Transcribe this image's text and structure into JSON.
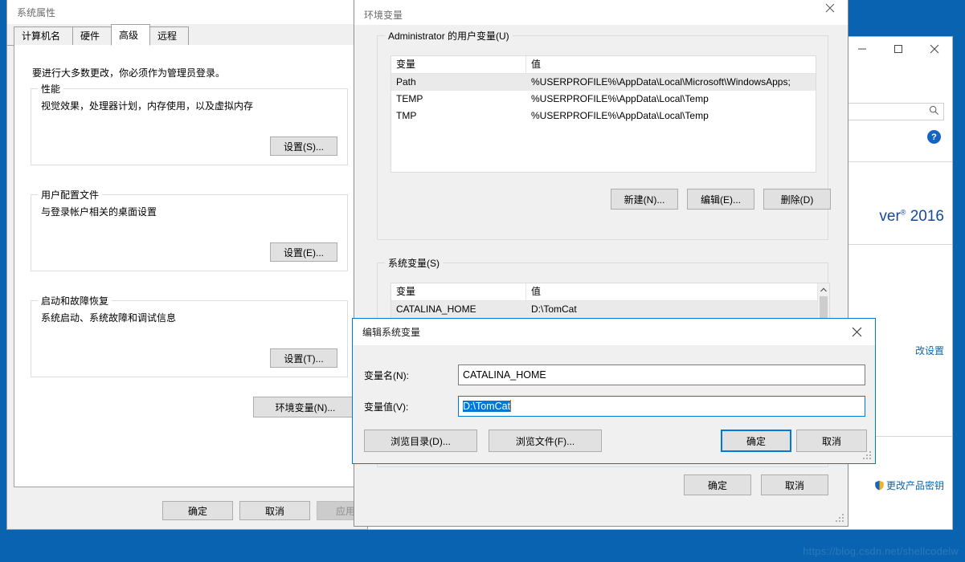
{
  "desktop": {
    "background_color": "#0963b0",
    "watermark": "https://blog.csdn.net/shellcodelw"
  },
  "control_panel_window": {
    "name": "system-control-panel",
    "minimize_label": "—",
    "maximize_label": "□",
    "close_label": "✕",
    "search_placeholder": "",
    "help_label": "?",
    "edition_text": "ver",
    "edition_trademark": "®",
    "edition_year": "2016",
    "change_settings_link": "改设置",
    "change_product_key_link": "更改产品密钥"
  },
  "system_properties": {
    "title": "系统属性",
    "tabs": [
      {
        "label": "计算机名",
        "active": false
      },
      {
        "label": "硬件",
        "active": false
      },
      {
        "label": "高级",
        "active": true
      },
      {
        "label": "远程",
        "active": false
      }
    ],
    "admin_note": "要进行大多数更改，你必须作为管理员登录。",
    "groups": [
      {
        "legend": "性能",
        "description": "视觉效果，处理器计划，内存使用，以及虚拟内存",
        "button": "设置(S)..."
      },
      {
        "legend": "用户配置文件",
        "description": "与登录帐户相关的桌面设置",
        "button": "设置(E)..."
      },
      {
        "legend": "启动和故障恢复",
        "description": "系统启动、系统故障和调试信息",
        "button": "设置(T)..."
      }
    ],
    "env_button": "环境变量(N)...",
    "footer": {
      "ok": "确定",
      "cancel": "取消",
      "apply": "应用(A)"
    }
  },
  "environment_variables": {
    "title": "环境变量",
    "close_label": "✕",
    "user_group": {
      "legend": "Administrator 的用户变量(U)",
      "columns": [
        "变量",
        "值"
      ],
      "rows": [
        {
          "name": "Path",
          "value": "%USERPROFILE%\\AppData\\Local\\Microsoft\\WindowsApps;",
          "selected": true
        },
        {
          "name": "TEMP",
          "value": "%USERPROFILE%\\AppData\\Local\\Temp",
          "selected": false
        },
        {
          "name": "TMP",
          "value": "%USERPROFILE%\\AppData\\Local\\Temp",
          "selected": false
        }
      ],
      "buttons": {
        "new": "新建(N)...",
        "edit": "编辑(E)...",
        "delete": "删除(D)"
      }
    },
    "system_group": {
      "legend": "系统变量(S)",
      "columns": [
        "变量",
        "值"
      ],
      "rows": [
        {
          "name": "CATALINA_HOME",
          "value": "D:\\TomCat",
          "selected": true
        }
      ]
    },
    "footer": {
      "ok": "确定",
      "cancel": "取消"
    }
  },
  "edit_system_variable": {
    "title": "编辑系统变量",
    "close_label": "✕",
    "name_label": "变量名(N):",
    "name_value": "CATALINA_HOME",
    "value_label": "变量值(V):",
    "value_value": "D:\\TomCat",
    "browse_dir": "浏览目录(D)...",
    "browse_file": "浏览文件(F)...",
    "ok": "确定",
    "cancel": "取消"
  }
}
